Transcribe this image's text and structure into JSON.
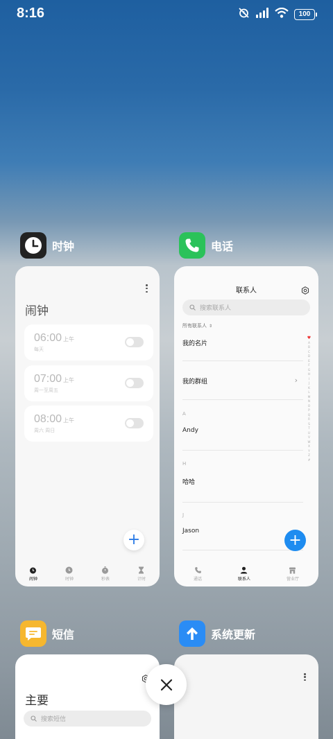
{
  "status_bar": {
    "time": "8:16",
    "battery": "100",
    "icons": [
      "alarm-off-icon",
      "signal-icon",
      "wifi-icon",
      "battery-icon"
    ]
  },
  "apps": {
    "clock": {
      "name": "时钟",
      "title": "闹钟",
      "alarms": [
        {
          "time": "06:00",
          "ampm": "上午",
          "repeat": "每天"
        },
        {
          "time": "07:00",
          "ampm": "上午",
          "repeat": "周一至周五"
        },
        {
          "time": "08:00",
          "ampm": "上午",
          "repeat": "周六 周日"
        }
      ],
      "tabs": [
        "闹钟",
        "时钟",
        "秒表",
        "计时"
      ]
    },
    "phone": {
      "name": "电话",
      "title": "联系人",
      "search_placeholder": "搜索联系人",
      "filter": "所有联系人",
      "my_card": "我的名片",
      "my_groups": "我的群组",
      "sections": [
        {
          "letter": "A",
          "name": "Andy"
        },
        {
          "letter": "H",
          "name": "哈哈"
        },
        {
          "letter": "J",
          "name": "Jason"
        }
      ],
      "alphabet": [
        "A",
        "B",
        "C",
        "D",
        "E",
        "F",
        "G",
        "H",
        "I",
        "J",
        "K",
        "L",
        "M",
        "N",
        "O",
        "P",
        "Q",
        "R",
        "S",
        "T",
        "U",
        "V",
        "W",
        "X",
        "Y",
        "Z",
        "#"
      ],
      "tabs": [
        "通话",
        "联系人",
        "营业厅"
      ]
    },
    "messages": {
      "name": "短信",
      "title": "主要",
      "search_placeholder": "搜索短信"
    },
    "updater": {
      "name": "系统更新"
    }
  },
  "colors": {
    "phone_green": "#2bc25a",
    "messages_yellow": "#f6b72f",
    "updater_blue": "#2a8cf5",
    "fab_blue": "#1e8cf0"
  }
}
